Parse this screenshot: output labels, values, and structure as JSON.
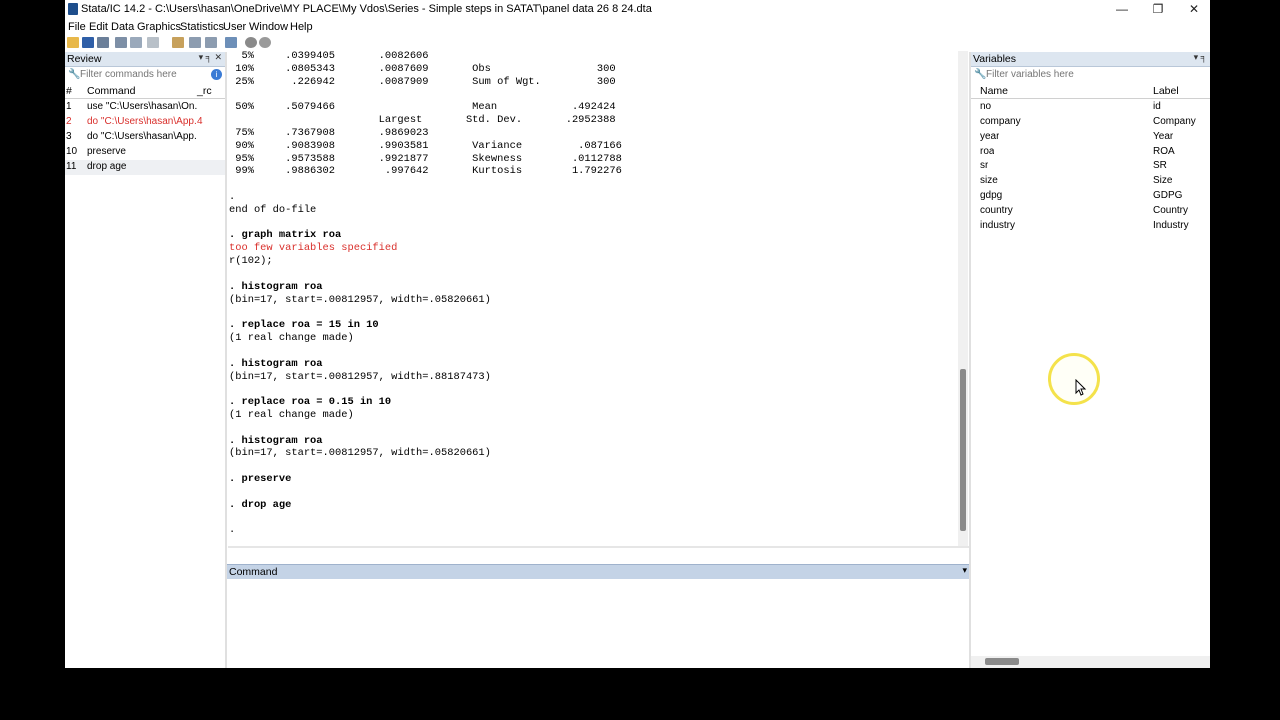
{
  "window": {
    "title": "Stata/IC 14.2 - C:\\Users\\hasan\\OneDrive\\MY PLACE\\My Vdos\\Series - Simple steps in SATAT\\panel data 26 8 24.dta",
    "minimize": "—",
    "maximize": "❐",
    "close": "✕"
  },
  "menu": [
    "File",
    "Edit",
    "Data",
    "Graphics",
    "Statistics",
    "User",
    "Window",
    "Help"
  ],
  "review": {
    "title": "Review",
    "pin": "▾ ╕ ✕",
    "filter_placeholder": "Filter commands here",
    "col_num": "#",
    "col_command": "Command",
    "col_rc": "_rc",
    "rows": [
      {
        "num": "1",
        "command": "use \"C:\\Users\\hasan\\On...",
        "rc": "",
        "error": false
      },
      {
        "num": "2",
        "command": "do \"C:\\Users\\hasan\\App...",
        "rc": "4",
        "error": true
      },
      {
        "num": "3",
        "command": "do \"C:\\Users\\hasan\\App...",
        "rc": "",
        "error": false
      },
      {
        "num": "10",
        "command": "preserve",
        "rc": "",
        "error": false
      },
      {
        "num": "11",
        "command": "drop age",
        "rc": "",
        "error": false
      }
    ]
  },
  "results": [
    {
      "text": "  5%     .0399405       .0082606",
      "style": "out"
    },
    {
      "text": " 10%     .0805343       .0087609       Obs                 300",
      "style": "out"
    },
    {
      "text": " 25%      .226942       .0087909       Sum of Wgt.         300",
      "style": "out"
    },
    {
      "text": "",
      "style": "out"
    },
    {
      "text": " 50%     .5079466                      Mean            .492424",
      "style": "out"
    },
    {
      "text": "                        Largest       Std. Dev.       .2952388",
      "style": "out"
    },
    {
      "text": " 75%     .7367908       .9869023",
      "style": "out"
    },
    {
      "text": " 90%     .9083908       .9903581       Variance         .087166",
      "style": "out"
    },
    {
      "text": " 95%     .9573588       .9921877       Skewness        .0112788",
      "style": "out"
    },
    {
      "text": " 99%     .9886302        .997642       Kurtosis        1.792276",
      "style": "out"
    },
    {
      "text": "",
      "style": "out"
    },
    {
      "text": ".",
      "style": "out"
    },
    {
      "text": "end of do-file",
      "style": "out"
    },
    {
      "text": "",
      "style": "out"
    },
    {
      "text": ". graph matrix roa",
      "style": "cmd"
    },
    {
      "text": "too few variables specified",
      "style": "err"
    },
    {
      "text": "r(102);",
      "style": "out"
    },
    {
      "text": "",
      "style": "out"
    },
    {
      "text": ". histogram roa",
      "style": "cmd"
    },
    {
      "text": "(bin=17, start=.00812957, width=.05820661)",
      "style": "out"
    },
    {
      "text": "",
      "style": "out"
    },
    {
      "text": ". replace roa = 15 in 10",
      "style": "cmd"
    },
    {
      "text": "(1 real change made)",
      "style": "out"
    },
    {
      "text": "",
      "style": "out"
    },
    {
      "text": ". histogram roa",
      "style": "cmd"
    },
    {
      "text": "(bin=17, start=.00812957, width=.88187473)",
      "style": "out"
    },
    {
      "text": "",
      "style": "out"
    },
    {
      "text": ". replace roa = 0.15 in 10",
      "style": "cmd"
    },
    {
      "text": "(1 real change made)",
      "style": "out"
    },
    {
      "text": "",
      "style": "out"
    },
    {
      "text": ". histogram roa",
      "style": "cmd"
    },
    {
      "text": "(bin=17, start=.00812957, width=.05820661)",
      "style": "out"
    },
    {
      "text": "",
      "style": "out"
    },
    {
      "text": ". preserve",
      "style": "cmd"
    },
    {
      "text": "",
      "style": "out"
    },
    {
      "text": ". drop age",
      "style": "cmd"
    },
    {
      "text": "",
      "style": "out"
    },
    {
      "text": ".",
      "style": "out"
    }
  ],
  "command": {
    "title": "Command",
    "pin": "▾",
    "value": ""
  },
  "variables": {
    "title": "Variables",
    "pin": "▾ ╕",
    "filter_placeholder": "Filter variables here",
    "col_name": "Name",
    "col_label": "Label",
    "rows": [
      {
        "name": "no",
        "label": "id"
      },
      {
        "name": "company",
        "label": "Company"
      },
      {
        "name": "year",
        "label": "Year"
      },
      {
        "name": "roa",
        "label": "ROA"
      },
      {
        "name": "sr",
        "label": "SR"
      },
      {
        "name": "size",
        "label": "Size"
      },
      {
        "name": "gdpg",
        "label": "GDPG"
      },
      {
        "name": "country",
        "label": "Country"
      },
      {
        "name": "industry",
        "label": "Industry"
      }
    ]
  },
  "colors": {
    "error": "#d9302c",
    "panel_header": "#dde6f0",
    "command_header": "#c4d3e6"
  }
}
